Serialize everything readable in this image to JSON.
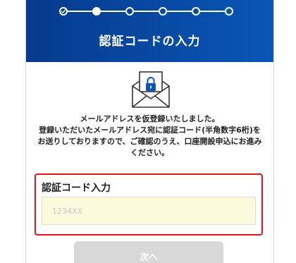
{
  "header": {
    "title": "認証コードの入力",
    "steps": [
      "done",
      "active",
      "pending",
      "pending",
      "pending",
      "pending"
    ]
  },
  "main": {
    "message_lines": [
      "メールアドレスを仮登録いたしました。",
      "登録いただいたメールアドレス宛に認証コード(半角数字6桁)を",
      "お送りしておりますので、ご確認のうえ、口座開設申込にお進み",
      "ください。"
    ],
    "code_section": {
      "label": "認証コード入力",
      "placeholder": "1234XX",
      "value": ""
    },
    "next_button_label": "次へ"
  },
  "colors": {
    "header_start": "#063a8d",
    "header_end": "#0a56b6",
    "highlight_border": "#e8101a",
    "input_bg": "#fdf9dc",
    "button_disabled": "#d8d8d8"
  },
  "icons": {
    "envelope": "envelope-lock-icon",
    "check": "check-icon"
  }
}
